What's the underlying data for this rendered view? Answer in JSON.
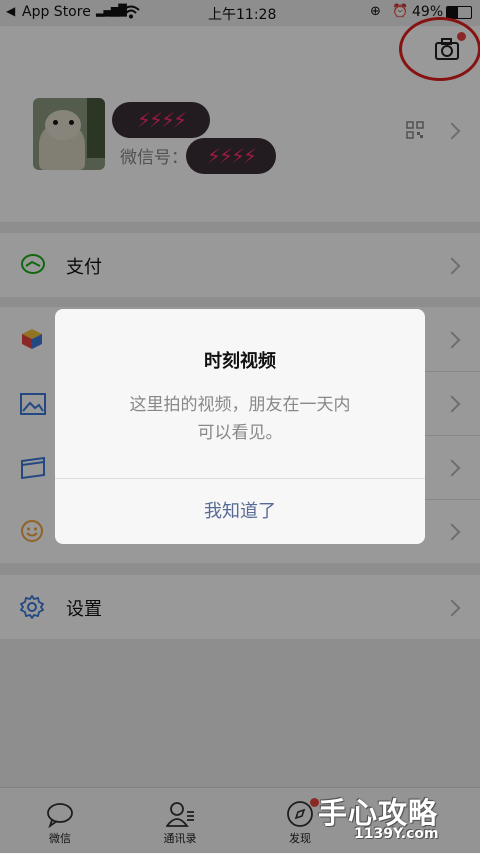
{
  "status_bar": {
    "back_app": "App Store",
    "time": "上午11:28",
    "battery": "49%"
  },
  "profile": {
    "wechat_id_label": "微信号："
  },
  "menu": {
    "pay": "支付",
    "settings": "设置"
  },
  "dialog": {
    "title": "时刻视频",
    "message_line1": "这里拍的视频，朋友在一天内",
    "message_line2": "可以看见。",
    "button": "我知道了"
  },
  "tabs": [
    {
      "label": "微信"
    },
    {
      "label": "通讯录"
    },
    {
      "label": "发现"
    }
  ],
  "watermark": {
    "text": "手心攻略",
    "domain": "1139Y.com"
  },
  "colors": {
    "accent_green": "#1aad19",
    "link_blue": "#576b95",
    "badge_red": "#e64340"
  }
}
